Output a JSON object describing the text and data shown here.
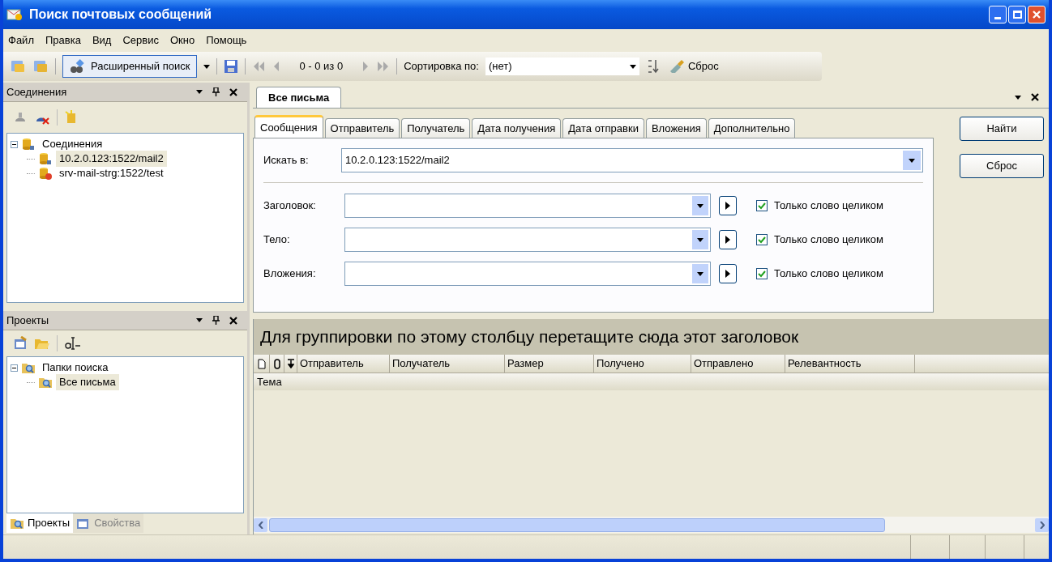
{
  "window": {
    "title": "Поиск почтовых сообщений"
  },
  "menu": [
    "Файл",
    "Правка",
    "Вид",
    "Сервис",
    "Окно",
    "Помощь"
  ],
  "toolbar": {
    "advanced_search": "Расширенный поиск",
    "page_info": "0 - 0 из 0",
    "sort_label": "Сортировка по:",
    "sort_value": "(нет)",
    "reset": "Сброс"
  },
  "connections_panel": {
    "title": "Соединения",
    "tree": [
      {
        "label": "Соединения",
        "expanded": true,
        "selected": false,
        "children": [
          {
            "label": "10.2.0.123:1522/mail2",
            "selected": true,
            "kind": "ok"
          },
          {
            "label": "srv-mail-strg:1522/test",
            "selected": false,
            "kind": "error"
          }
        ]
      }
    ]
  },
  "projects_panel": {
    "title": "Проекты",
    "tree": [
      {
        "label": "Папки поиска",
        "expanded": true,
        "selected": false,
        "children": [
          {
            "label": "Все письма",
            "selected": true
          }
        ]
      }
    ]
  },
  "bottom_tabs": [
    {
      "label": "Проекты",
      "selected": true
    },
    {
      "label": "Свойства",
      "selected": false
    }
  ],
  "document_tab": {
    "label": "Все письма",
    "selected": true
  },
  "search_tabs": [
    {
      "label": "Сообщения",
      "selected": true
    },
    {
      "label": "Отправитель",
      "selected": false
    },
    {
      "label": "Получатель",
      "selected": false
    },
    {
      "label": "Дата получения",
      "selected": false
    },
    {
      "label": "Дата отправки",
      "selected": false
    },
    {
      "label": "Вложения",
      "selected": false
    },
    {
      "label": "Дополнительно",
      "selected": false
    }
  ],
  "form": {
    "search_in_label": "Искать в:",
    "search_in_value": "10.2.0.123:1522/mail2",
    "fields": [
      {
        "label": "Заголовок:",
        "checkbox_label": "Только слово целиком",
        "checked": true
      },
      {
        "label": "Тело:",
        "checkbox_label": "Только слово целиком",
        "checked": true
      },
      {
        "label": "Вложения:",
        "checkbox_label": "Только слово целиком",
        "checked": true
      }
    ]
  },
  "buttons": [
    "Найти",
    "Сброс"
  ],
  "group_hint": "Для группировки по этому столбцу перетащите сюда этот заголовок",
  "columns": [
    "Отправитель",
    "Получатель",
    "Размер",
    "Получено",
    "Отправлено",
    "Релевантность"
  ],
  "subject_column": "Тема"
}
